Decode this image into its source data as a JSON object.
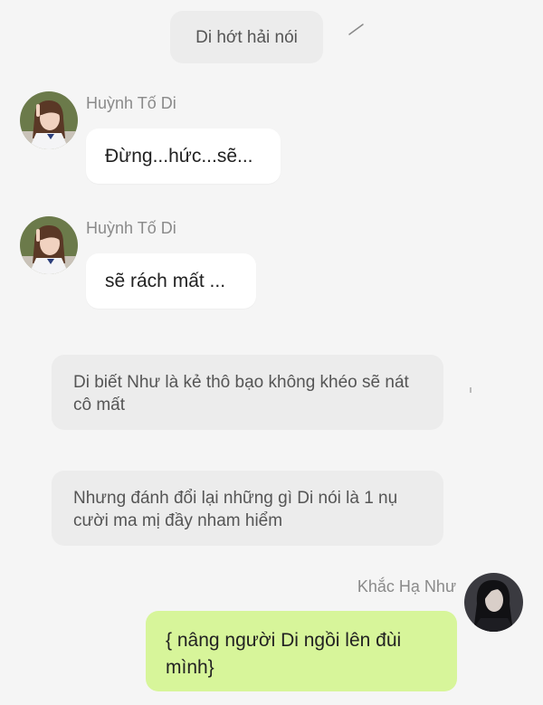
{
  "narration": [
    "Di hớt hải nói",
    "Di biết Như là kẻ thô bạo không khéo sẽ nát cô mất",
    "Nhưng đánh đổi lại những gì Di nói là 1 nụ cười ma mị đầy nham hiểm"
  ],
  "messages": [
    {
      "sender": "Huỳnh Tố Di",
      "text": "Đừng...hức...sẽ..."
    },
    {
      "sender": "Huỳnh Tố Di",
      "text": "sẽ rách mất ..."
    },
    {
      "sender": "Khắc Hạ Như",
      "text": "{ nâng người Di ngồi lên đùi mình}"
    }
  ],
  "colors": {
    "background": "#f5f5f5",
    "narration_bubble": "#ececec",
    "incoming_bubble": "#ffffff",
    "outgoing_bubble": "#d7f59a"
  }
}
